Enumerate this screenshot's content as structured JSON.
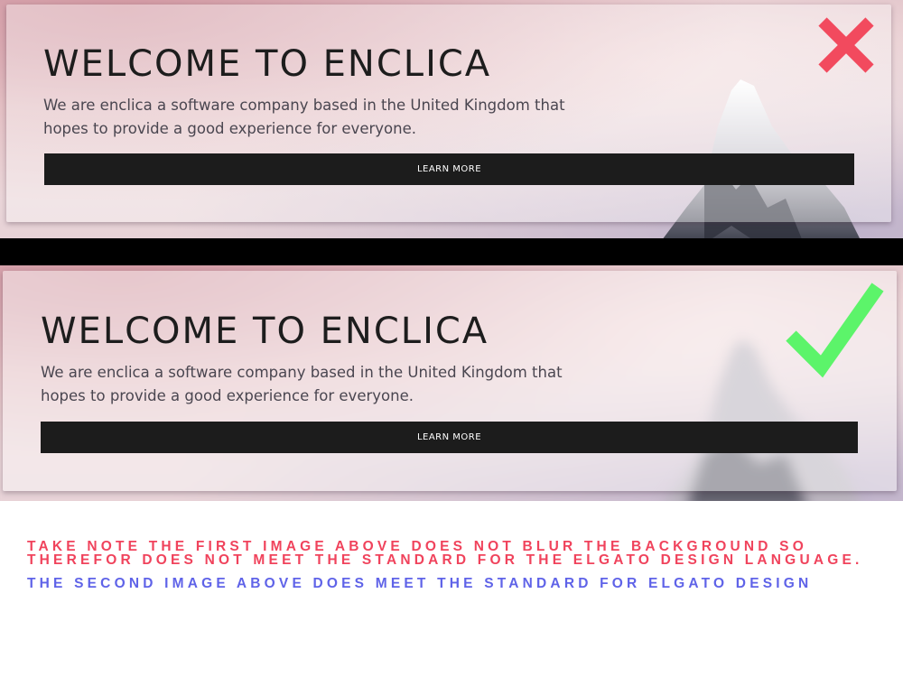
{
  "colors": {
    "fail": "#f0435c",
    "pass": "#5f63e8",
    "cross": "#f24a5e",
    "check": "#5cf46a",
    "button_bg": "#1c1c1c"
  },
  "icons": {
    "cross": "cross-icon",
    "check": "checkmark-icon"
  },
  "example_unblurred": {
    "title": "WELCOME TO ENCLICA",
    "description": "We are enclica a software company based in the United Kingdom that hopes to provide a good experience for everyone.",
    "button_label": "LEARN MORE"
  },
  "example_blurred": {
    "title": "WELCOME TO ENCLICA",
    "description": "We are enclica a software company based in the United Kingdom that hopes to provide a good experience for everyone.",
    "button_label": "LEARN MORE"
  },
  "notes": {
    "fail_note": "TAKE NOTE THE FIRST IMAGE ABOVE DOES NOT BLUR THE BACKGROUND SO THEREFOR DOES NOT MEET THE STANDARD FOR THE ELGATO DESIGN LANGUAGE.",
    "pass_note": "THE SECOND IMAGE ABOVE DOES MEET THE STANDARD FOR ELGATO DESIGN"
  }
}
